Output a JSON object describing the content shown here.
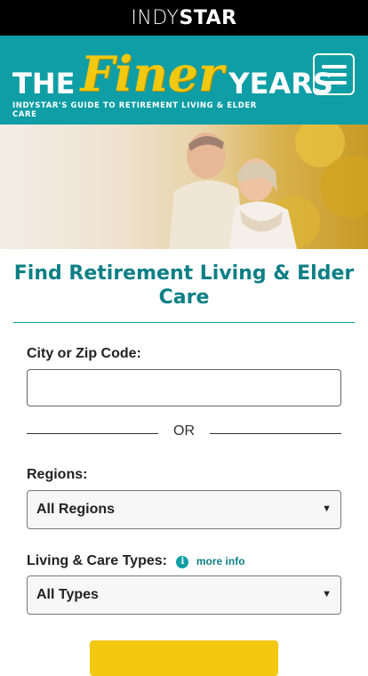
{
  "topbar": {
    "brand_indy": "INDY",
    "brand_star": "STAR"
  },
  "header": {
    "logo_the": "THE",
    "logo_finer": "Finer",
    "logo_years": "YEARS",
    "tagline": "INDYSTAR'S GUIDE TO RETIREMENT LIVING & ELDER CARE",
    "menu_icon": "hamburger-menu-icon"
  },
  "search": {
    "title": "Find Retirement Living & Elder Care",
    "city_label": "City or Zip Code:",
    "city_value": "",
    "city_placeholder": "",
    "or_text": "OR",
    "regions_label": "Regions:",
    "regions_selected": "All Regions",
    "types_label": "Living & Care Types:",
    "more_info": "more info",
    "types_selected": "All Types"
  },
  "colors": {
    "topbar": "#000000",
    "header_teal": "#0f9ea5",
    "title_teal": "#0d7f86",
    "logo_gold": "#f2c811",
    "button_yellow": "#f2c811"
  }
}
